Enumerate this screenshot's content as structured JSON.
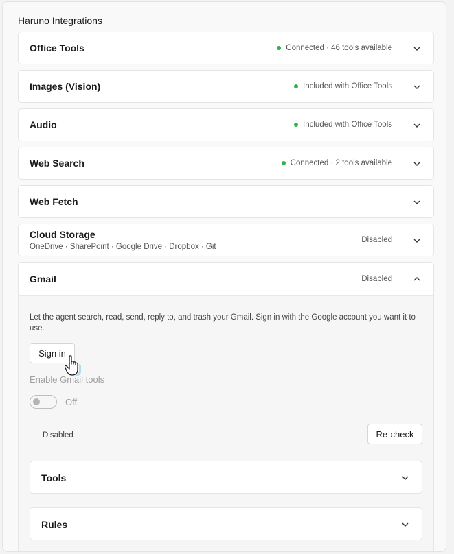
{
  "section_title": "Haruno Integrations",
  "integrations": [
    {
      "name": "Office Tools",
      "status": "Connected · 46 tools available",
      "status_color": "#2fb34a"
    },
    {
      "name": "Images (Vision)",
      "status": "Included with Office Tools",
      "status_color": "#2fb34a"
    },
    {
      "name": "Audio",
      "status": "Included with Office Tools",
      "status_color": "#2fb34a"
    },
    {
      "name": "Web Search",
      "status": "Connected · 2 tools available",
      "status_color": "#2fb34a"
    },
    {
      "name": "Web Fetch",
      "status": ""
    },
    {
      "name": "Cloud Storage",
      "subtitle": "OneDrive · SharePoint · Google Drive · Dropbox · Git",
      "status": "Disabled"
    }
  ],
  "gmail": {
    "name": "Gmail",
    "status": "Disabled",
    "description": "Let the agent search, read, send, reply to, and trash your Gmail. Sign in with the Google account you want it to use.",
    "sign_in_label": "Sign in",
    "enable_label": "Enable Gmail tools",
    "toggle_state": "Off",
    "toggle_on": false,
    "connection_status": "Disabled",
    "recheck_label": "Re-check",
    "tools_label": "Tools",
    "rules_label": "Rules"
  },
  "icons": {
    "expand": "chevron-down-icon",
    "collapse": "chevron-up-icon",
    "status_dot": "status-dot-icon",
    "cursor": "hand-pointer-icon"
  }
}
